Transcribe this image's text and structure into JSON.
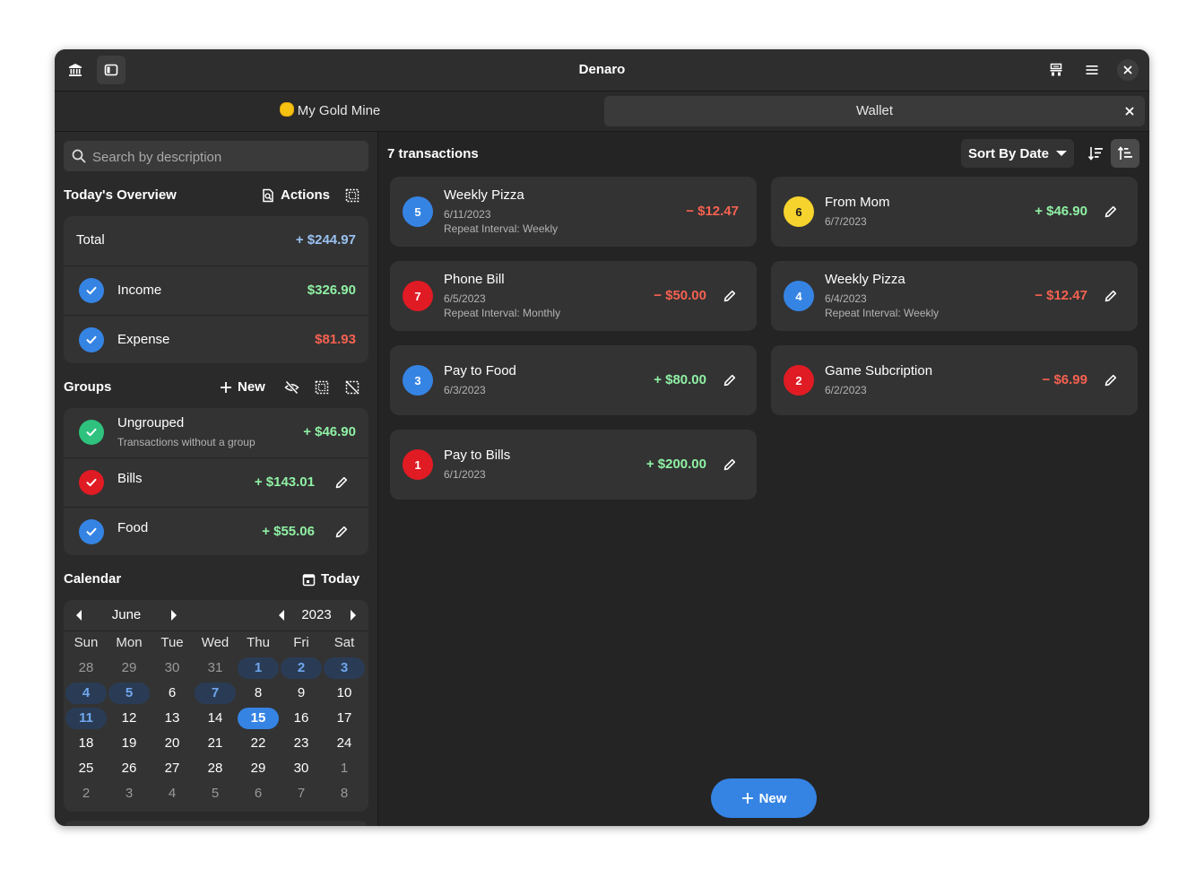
{
  "window": {
    "title": "Denaro"
  },
  "tabs": [
    {
      "label": "My Gold Mine",
      "icon": "coin-emoji"
    },
    {
      "label": "Wallet"
    }
  ],
  "search": {
    "placeholder": "Search by description"
  },
  "overview": {
    "title": "Today's Overview",
    "actions_label": "Actions",
    "total": {
      "label": "Total",
      "amount": "+ $244.97"
    },
    "income": {
      "label": "Income",
      "amount": "$326.90"
    },
    "expense": {
      "label": "Expense",
      "amount": "$81.93"
    }
  },
  "groups": {
    "title": "Groups",
    "new_label": "New",
    "items": [
      {
        "name": "Ungrouped",
        "description": "Transactions without a group",
        "amount": "+ $46.90",
        "color": "#2ec27e"
      },
      {
        "name": "Bills",
        "description": "",
        "amount": "+ $143.01",
        "color": "#e01b24"
      },
      {
        "name": "Food",
        "description": "",
        "amount": "+ $55.06",
        "color": "#3584e4"
      }
    ]
  },
  "calendar": {
    "title": "Calendar",
    "today_label": "Today",
    "month": "June",
    "year": "2023",
    "weekdays": [
      "Sun",
      "Mon",
      "Tue",
      "Wed",
      "Thu",
      "Fri",
      "Sat"
    ],
    "weeks": [
      [
        "28",
        "29",
        "30",
        "31",
        "1",
        "2",
        "3"
      ],
      [
        "4",
        "5",
        "6",
        "7",
        "8",
        "9",
        "10"
      ],
      [
        "11",
        "12",
        "13",
        "14",
        "15",
        "16",
        "17"
      ],
      [
        "18",
        "19",
        "20",
        "21",
        "22",
        "23",
        "24"
      ],
      [
        "25",
        "26",
        "27",
        "28",
        "29",
        "30",
        "1"
      ],
      [
        "2",
        "3",
        "4",
        "5",
        "6",
        "7",
        "8"
      ]
    ],
    "marked_days": [
      "1",
      "2",
      "3",
      "4",
      "5",
      "7",
      "11"
    ],
    "selected_day": "15"
  },
  "transactions": {
    "count_label": "7 transactions",
    "sort_label": "Sort By Date",
    "items": [
      {
        "id": "5",
        "name": "Weekly Pizza",
        "date": "6/11/2023",
        "repeat": "Repeat Interval: Weekly",
        "amount": "− $12.47",
        "type": "expense",
        "color": "#3584e4",
        "editable": false
      },
      {
        "id": "6",
        "name": "From Mom",
        "date": "6/7/2023",
        "repeat": "",
        "amount": "+ $46.90",
        "type": "income",
        "color": "#f6d32d",
        "editable": true
      },
      {
        "id": "7",
        "name": "Phone Bill",
        "date": "6/5/2023",
        "repeat": "Repeat Interval: Monthly",
        "amount": "− $50.00",
        "type": "expense",
        "color": "#e01b24",
        "editable": true
      },
      {
        "id": "4",
        "name": "Weekly Pizza",
        "date": "6/4/2023",
        "repeat": "Repeat Interval: Weekly",
        "amount": "− $12.47",
        "type": "expense",
        "color": "#3584e4",
        "editable": true
      },
      {
        "id": "3",
        "name": "Pay to Food",
        "date": "6/3/2023",
        "repeat": "",
        "amount": "+ $80.00",
        "type": "income",
        "color": "#3584e4",
        "editable": true
      },
      {
        "id": "2",
        "name": "Game Subcription",
        "date": "6/2/2023",
        "repeat": "",
        "amount": "− $6.99",
        "type": "expense",
        "color": "#e01b24",
        "editable": true
      },
      {
        "id": "1",
        "name": "Pay to Bills",
        "date": "6/1/2023",
        "repeat": "",
        "amount": "+ $200.00",
        "type": "income",
        "color": "#e01b24",
        "editable": true
      }
    ]
  },
  "fab": {
    "label": "New"
  },
  "colors": {
    "accent": "#3584e4",
    "income": "#8ff0a4",
    "expense": "#f66151",
    "total": "#99c1f1"
  }
}
